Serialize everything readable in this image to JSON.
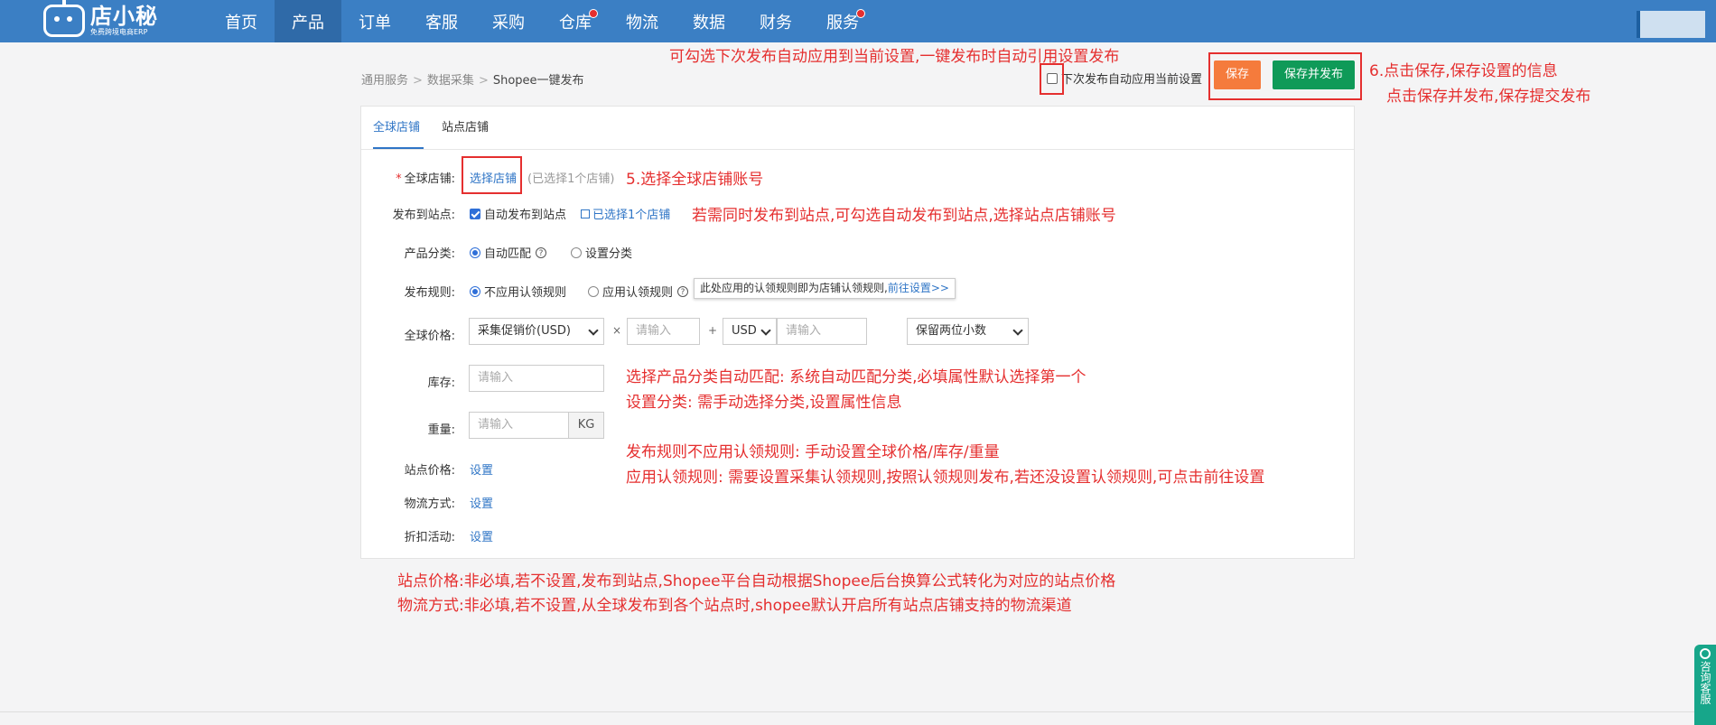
{
  "nav": {
    "logo_title": "店小秘",
    "logo_sub": "免费跨境电商ERP",
    "items": [
      {
        "label": "首页",
        "dot": false
      },
      {
        "label": "产品",
        "dot": false
      },
      {
        "label": "订单",
        "dot": false
      },
      {
        "label": "客服",
        "dot": false
      },
      {
        "label": "采购",
        "dot": false
      },
      {
        "label": "仓库",
        "dot": true
      },
      {
        "label": "物流",
        "dot": false
      },
      {
        "label": "数据",
        "dot": false
      },
      {
        "label": "财务",
        "dot": false
      },
      {
        "label": "服务",
        "dot": true
      }
    ],
    "active_index": 1
  },
  "breadcrumb": [
    "通用服务",
    "数据采集",
    "Shopee一键发布"
  ],
  "header": {
    "auto_apply_label": "下次发布自动应用当前设置",
    "save_label": "保存",
    "save_publish_label": "保存并发布"
  },
  "tabs": [
    "全球店铺",
    "站点店铺"
  ],
  "form": {
    "store_label": "全球店铺:",
    "store_link": "选择店铺",
    "store_count": "(已选择1个店铺)",
    "publish_site_label": "发布到站点:",
    "auto_publish_label": "自动发布到站点",
    "selected_sites_link": "已选择1个店铺",
    "category_label": "产品分类:",
    "category_auto": "自动匹配",
    "category_manual": "设置分类",
    "rule_label": "发布规则:",
    "rule_none": "不应用认领规则",
    "rule_apply": "应用认领规则",
    "tooltip_text": "此处应用的认领规则即为店铺认领规则,",
    "tooltip_link": "前往设置>>",
    "price_label": "全球价格:",
    "price_base": "采集促销价(USD)",
    "times": "×",
    "multiplier_placeholder": "请输入",
    "plus": "+",
    "currency": "USD",
    "addend_placeholder": "请输入",
    "rounding": "保留两位小数",
    "stock_label": "库存:",
    "stock_placeholder": "请输入",
    "weight_label": "重量:",
    "weight_placeholder": "请输入",
    "weight_unit": "KG",
    "site_price_label": "站点价格:",
    "site_price_link": "设置",
    "logistics_label": "物流方式:",
    "logistics_link": "设置",
    "discount_label": "折扣活动:",
    "discount_link": "设置"
  },
  "annotations": {
    "top": "可勾选下次发布自动应用到当前设置,一键发布时自动引用设置发布",
    "save1": "6.点击保存,保存设置的信息",
    "save2": "点击保存并发布,保存提交发布",
    "store": "5.选择全球店铺账号",
    "site": "若需同时发布到站点,可勾选自动发布到站点,选择站点店铺账号",
    "cat1": "选择产品分类自动匹配: 系统自动匹配分类,必填属性默认选择第一个",
    "cat2": "设置分类: 需手动选择分类,设置属性信息",
    "rule1": "发布规则不应用认领规则: 手动设置全球价格/库存/重量",
    "rule2": "应用认领规则: 需要设置采集认领规则,按照认领规则发布,若还没设置认领规则,可点击前往设置",
    "sitep": "站点价格:非必填,若不设置,发布到站点,Shopee平台自动根据Shopee后台换算公式转化为对应的站点价格",
    "logi": "物流方式:非必填,若不设置,从全球发布到各个站点时,shopee默认开启所有站点店铺支持的物流渠道"
  },
  "consult": "咨询客服",
  "colors": {
    "nav_bg": "#3b7fc4",
    "accent": "#2f75c6",
    "save": "#f57b3c",
    "save_publish": "#0f9a58",
    "annotation": "#e52f2f"
  }
}
